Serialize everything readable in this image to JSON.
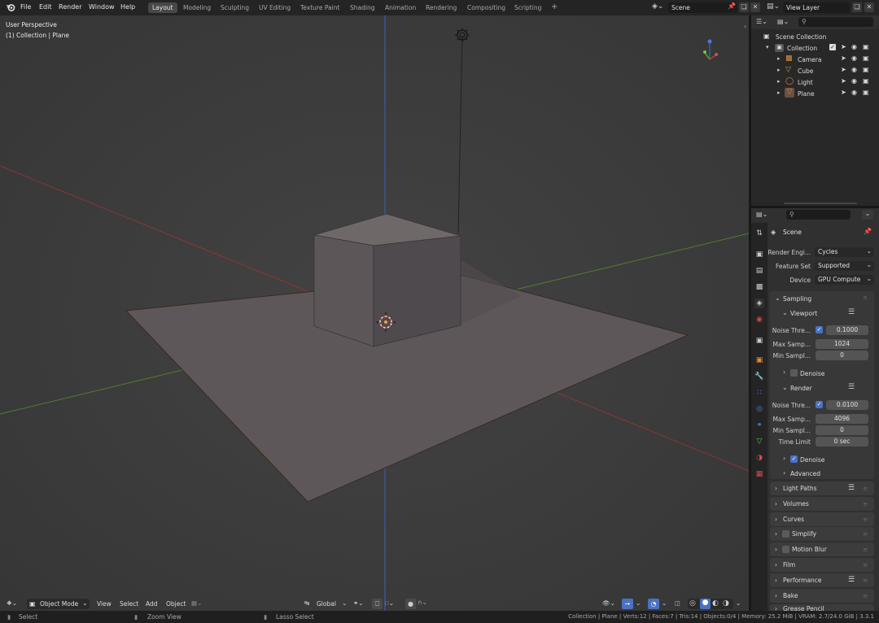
{
  "topbar": {
    "menus": [
      "File",
      "Edit",
      "Render",
      "Window",
      "Help"
    ],
    "workspaces": [
      "Layout",
      "Modeling",
      "Sculpting",
      "UV Editing",
      "Texture Paint",
      "Shading",
      "Animation",
      "Rendering",
      "Compositing",
      "Scripting"
    ],
    "active_workspace": "Layout",
    "add_workspace": "+",
    "scene_name": "Scene",
    "view_layer": "View Layer"
  },
  "viewport": {
    "perspective_label": "User Perspective",
    "context_label": "(1) Collection | Plane",
    "bg_color": "#3d3d3d",
    "x_axis_color": "#b23a3a",
    "y_axis_color": "#5a8c2c",
    "z_axis_color": "#3a5ca8"
  },
  "viewport_header": {
    "mode": "Object Mode",
    "menus": [
      "View",
      "Select",
      "Add",
      "Object"
    ],
    "orientation": "Global"
  },
  "outliner": {
    "root": "Scene Collection",
    "collection": "Collection",
    "items": [
      {
        "name": "Camera",
        "icon": "camera-icon",
        "color": "#e08d3c"
      },
      {
        "name": "Cube",
        "icon": "mesh-icon",
        "color": "#e08d3c"
      },
      {
        "name": "Light",
        "icon": "light-icon",
        "color": "#e08d3c"
      },
      {
        "name": "Plane",
        "icon": "mesh-icon",
        "color": "#e08d3c"
      }
    ]
  },
  "properties": {
    "context": "Scene",
    "render_engine_label": "Render Engi...",
    "render_engine": "Cycles",
    "feature_set_label": "Feature Set",
    "feature_set": "Supported",
    "device_label": "Device",
    "device": "GPU Compute",
    "sampling": "Sampling",
    "viewport_sub": "Viewport",
    "vp_noise_label": "Noise Thre...",
    "vp_noise": "0.1000",
    "vp_max_label": "Max Samp...",
    "vp_max": "1024",
    "vp_min_label": "Min Sampl...",
    "vp_min": "0",
    "vp_denoise": "Denoise",
    "render_sub": "Render",
    "r_noise_label": "Noise Thre...",
    "r_noise": "0.0100",
    "r_max_label": "Max Samp...",
    "r_max": "4096",
    "r_min_label": "Min Sampl...",
    "r_min": "0",
    "time_limit_label": "Time Limit",
    "time_limit": "0 sec",
    "r_denoise": "Denoise",
    "advanced": "Advanced",
    "panels": [
      "Light Paths",
      "Volumes",
      "Curves",
      "Simplify",
      "Motion Blur",
      "Film",
      "Performance",
      "Bake",
      "Grease Pencil"
    ],
    "accent": "#4a72c4"
  },
  "statusbar": {
    "select": "Select",
    "zoom": "Zoom View",
    "lasso": "Lasso Select",
    "stats": "Collection | Plane | Verts:12 | Faces:7 | Tris:14 | Objects:0/4 | Memory: 25.2 MiB | VRAM: 2.7/24.0 GiB | 3.3.1"
  }
}
